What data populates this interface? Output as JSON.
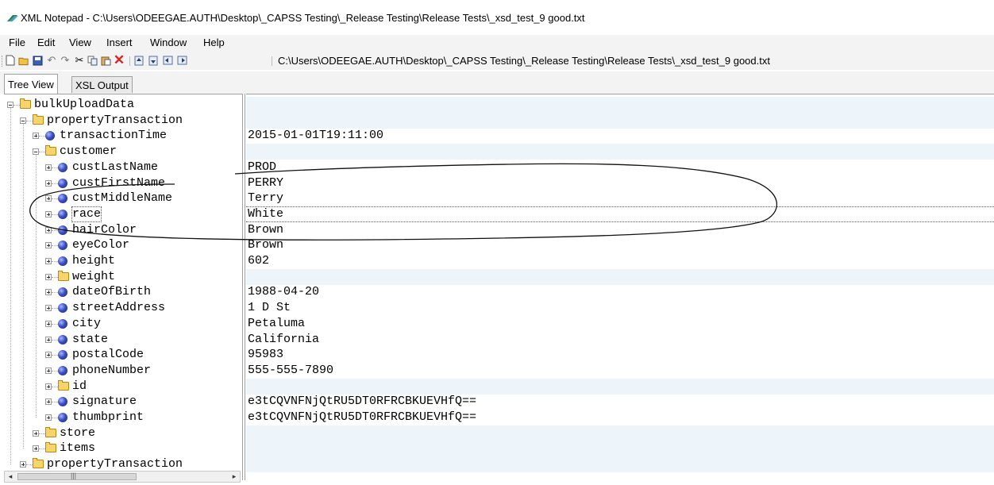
{
  "window": {
    "title": "XML Notepad - C:\\Users\\ODEEGAE.AUTH\\Desktop\\_CAPSS Testing\\_Release Testing\\Release Tests\\_xsd_test_9 good.txt"
  },
  "menu": {
    "items": [
      {
        "label": "File"
      },
      {
        "label": "Edit"
      },
      {
        "label": "View"
      },
      {
        "label": "Insert"
      },
      {
        "label": "Window"
      },
      {
        "label": "Help"
      }
    ]
  },
  "toolbar": {
    "location": "C:\\Users\\ODEEGAE.AUTH\\Desktop\\_CAPSS Testing\\_Release Testing\\Release Tests\\_xsd_test_9 good.txt",
    "icons": [
      "new-file-icon",
      "open-folder-icon",
      "save-icon",
      "undo-icon",
      "redo-icon",
      "cut-icon",
      "copy-icon",
      "paste-icon",
      "delete-icon",
      "nudge-up-icon",
      "nudge-down-icon",
      "nudge-left-icon",
      "nudge-right-icon"
    ]
  },
  "tabs": [
    {
      "label": "Tree View",
      "active": true
    },
    {
      "label": "XSL Output",
      "active": false
    }
  ],
  "tree": {
    "nodes": [
      {
        "label": "bulkUploadData",
        "level": 0,
        "icon": "folder",
        "expander": "minus",
        "value": ""
      },
      {
        "label": "propertyTransaction",
        "level": 1,
        "icon": "folder",
        "expander": "minus",
        "value": ""
      },
      {
        "label": "transactionTime",
        "level": 2,
        "icon": "element",
        "expander": "plus",
        "value": "2015-01-01T19:11:00"
      },
      {
        "label": "customer",
        "level": 2,
        "icon": "folder",
        "expander": "minus",
        "value": ""
      },
      {
        "label": "custLastName",
        "level": 3,
        "icon": "element",
        "expander": "plus",
        "value": "PROD"
      },
      {
        "label": "custFirstName",
        "level": 3,
        "icon": "element",
        "expander": "plus",
        "value": "PERRY"
      },
      {
        "label": "custMiddleName",
        "level": 3,
        "icon": "element",
        "expander": "plus",
        "value": "Terry"
      },
      {
        "label": "race",
        "level": 3,
        "icon": "element",
        "expander": "plus",
        "value": "White",
        "selected": true
      },
      {
        "label": "hairColor",
        "level": 3,
        "icon": "element",
        "expander": "plus",
        "value": "Brown"
      },
      {
        "label": "eyeColor",
        "level": 3,
        "icon": "element",
        "expander": "plus",
        "value": "Brown"
      },
      {
        "label": "height",
        "level": 3,
        "icon": "element",
        "expander": "plus",
        "value": "602"
      },
      {
        "label": "weight",
        "level": 3,
        "icon": "folder",
        "expander": "plus",
        "value": ""
      },
      {
        "label": "dateOfBirth",
        "level": 3,
        "icon": "element",
        "expander": "plus",
        "value": "1988-04-20"
      },
      {
        "label": "streetAddress",
        "level": 3,
        "icon": "element",
        "expander": "plus",
        "value": "1 D St"
      },
      {
        "label": "city",
        "level": 3,
        "icon": "element",
        "expander": "plus",
        "value": "Petaluma"
      },
      {
        "label": "state",
        "level": 3,
        "icon": "element",
        "expander": "plus",
        "value": "California"
      },
      {
        "label": "postalCode",
        "level": 3,
        "icon": "element",
        "expander": "plus",
        "value": "95983"
      },
      {
        "label": "phoneNumber",
        "level": 3,
        "icon": "element",
        "expander": "plus",
        "value": "555-555-7890"
      },
      {
        "label": "id",
        "level": 3,
        "icon": "folder",
        "expander": "plus",
        "value": ""
      },
      {
        "label": "signature",
        "level": 3,
        "icon": "element",
        "expander": "plus",
        "value": "e3tCQVNFNjQtRU5DT0RFRCBKUEVHfQ=="
      },
      {
        "label": "thumbprint",
        "level": 3,
        "icon": "element",
        "expander": "plus",
        "value": "e3tCQVNFNjQtRU5DT0RFRCBKUEVHfQ=="
      },
      {
        "label": "store",
        "level": 2,
        "icon": "folder",
        "expander": "plus",
        "value": ""
      },
      {
        "label": "items",
        "level": 2,
        "icon": "folder",
        "expander": "plus",
        "value": ""
      },
      {
        "label": "propertyTransaction",
        "level": 1,
        "icon": "folder",
        "expander": "plus",
        "value": ""
      }
    ]
  },
  "scrollbar": {
    "left_arrow": "◂",
    "right_arrow": "▸",
    "grip": "|||"
  },
  "colors": {
    "value_band": "#eef5fa",
    "folder": "#f7d46b",
    "element_icon": "#3b4fc4",
    "annotation_ink": "#111111"
  }
}
